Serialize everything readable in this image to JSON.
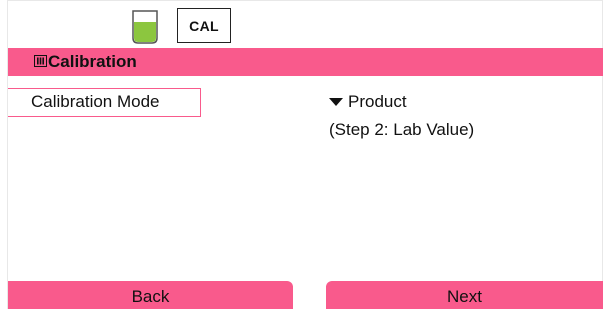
{
  "status_bar": {
    "beaker_icon": "beaker-icon",
    "cal_label": "CAL"
  },
  "header": {
    "icon": "menu-book-icon",
    "title": "Calibration"
  },
  "parameter": {
    "label": "Calibration Mode",
    "value": "Product",
    "caret_icon": "dropdown-caret-icon",
    "sub_value": "(Step 2: Lab Value)"
  },
  "softkeys": {
    "left": "Back",
    "right": "Next"
  },
  "colors": {
    "accent": "#f95a8c",
    "beaker_fill": "#8cc63f"
  }
}
